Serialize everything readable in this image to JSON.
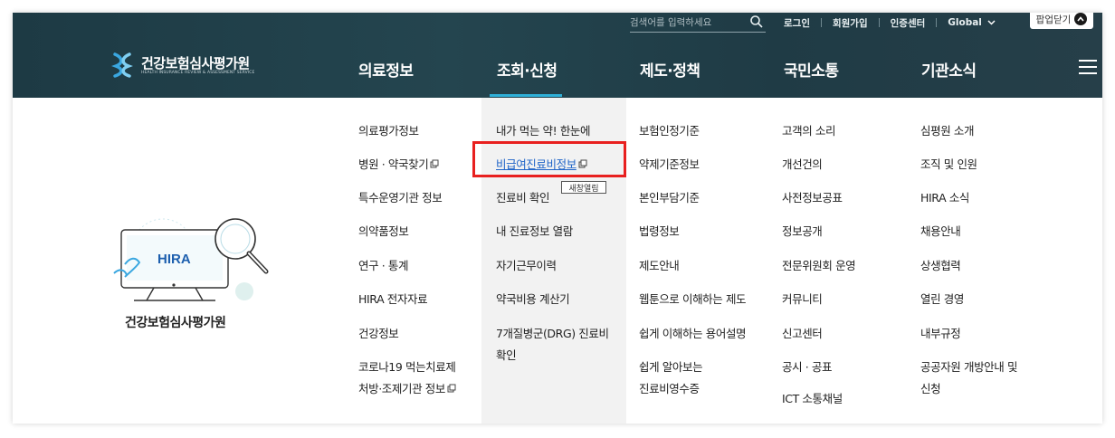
{
  "header": {
    "search_placeholder": "검색어를 입력하세요",
    "util_links": [
      "로그인",
      "회원가입",
      "인증센터"
    ],
    "global_label": "Global",
    "popup_label": "팝업닫기",
    "logo_title": "건강보험심사평가원",
    "logo_sub": "HEALTH INSURANCE REVIEW & ASSESSMENT SERVICE",
    "nav": [
      "의료정보",
      "조회·신청",
      "제도·정책",
      "국민소통",
      "기관소식"
    ],
    "active_nav_index": 1
  },
  "columns": [
    {
      "items": [
        "의료평가정보",
        "병원 · 약국찾기",
        "특수운영기관 정보",
        "의약품정보",
        "연구 · 통계",
        "HIRA 전자자료",
        "건강정보",
        "코로나19 먹는치료제",
        "처방·조제기관 정보"
      ]
    },
    {
      "items": [
        "내가 먹는 약! 한눈에",
        "비급여진료비정보",
        "진료비 확인",
        "내 진료정보 열람",
        "자기근무이력",
        "약국비용 계산기",
        "7개질병군(DRG) 진료비",
        "확인"
      ]
    },
    {
      "items": [
        "보험인정기준",
        "약제기준정보",
        "본인부담기준",
        "법령정보",
        "제도안내",
        "웹툰으로 이해하는 제도",
        "쉽게 이해하는 용어설명",
        "쉽게 알아보는",
        "진료비영수증"
      ]
    },
    {
      "items": [
        "고객의 소리",
        "개선건의",
        "사전정보공표",
        "정보공개",
        "전문위원회 운영",
        "커뮤니티",
        "신고센터",
        "공시 · 공표",
        "ICT 소통채널"
      ]
    },
    {
      "items": [
        "심평원 소개",
        "조직 및 인원",
        "HIRA 소식",
        "채용안내",
        "상생협력",
        "열린 경영",
        "내부규정",
        "공공자원 개방안내 및",
        "신청"
      ]
    }
  ],
  "tooltip": "새창열림",
  "illustration": {
    "monitor_label": "HIRA",
    "caption": "건강보험심사평가원"
  },
  "colors": {
    "header_bg": "#1f3b45",
    "accent": "#2fb0d8",
    "link_active": "#1f64c8",
    "highlight": "#e8201f"
  }
}
